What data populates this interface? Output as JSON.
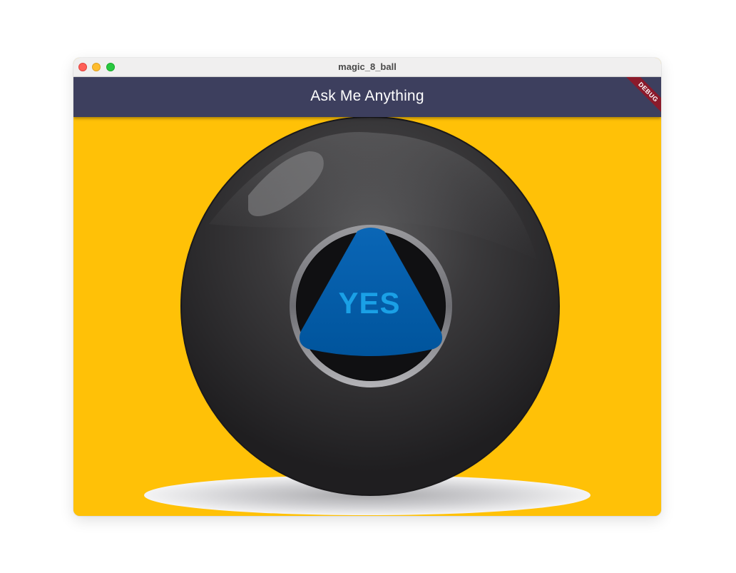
{
  "window": {
    "title": "magic_8_ball"
  },
  "appbar": {
    "title": "Ask Me Anything",
    "debug_label": "DEBUG"
  },
  "ball": {
    "answer": "YES"
  },
  "colors": {
    "background": "#ffc107",
    "appbar": "#3d3f5e",
    "answer_text": "#1aa0e6",
    "triangle": "#0062b8",
    "ball": "#2e2d2f"
  },
  "icons": {
    "close": "close-traffic-light-icon",
    "minimize": "minimize-traffic-light-icon",
    "maximize": "maximize-traffic-light-icon"
  }
}
